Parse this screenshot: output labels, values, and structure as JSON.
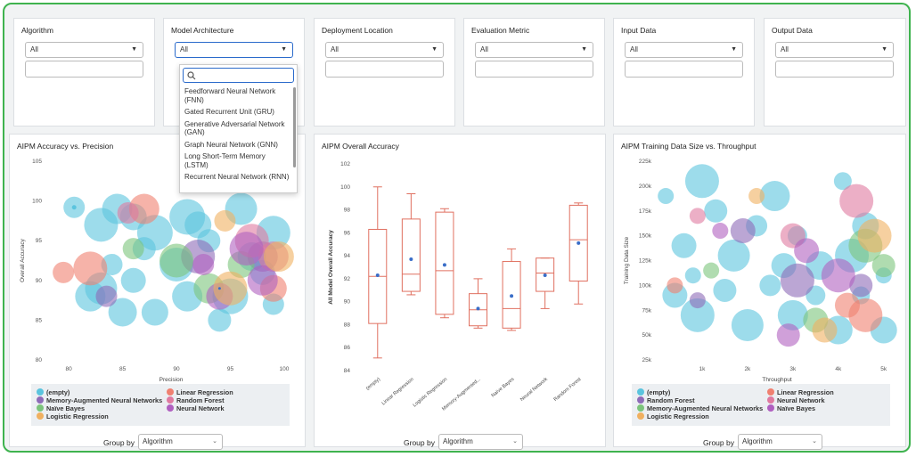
{
  "filters": [
    {
      "label": "Algorithm",
      "value": "All"
    },
    {
      "label": "Model Architecture",
      "value": "All"
    },
    {
      "label": "Deployment Location",
      "value": "All"
    },
    {
      "label": "Evaluation Metric",
      "value": "All"
    },
    {
      "label": "Input Data",
      "value": "All"
    },
    {
      "label": "Output Data",
      "value": "All"
    }
  ],
  "dropdown": {
    "items": [
      "Feedforward Neural Network (FNN)",
      "Gated Recurrent Unit (GRU)",
      "Generative Adversarial Network (GAN)",
      "Graph Neural Network (GNN)",
      "Long Short-Term Memory (LSTM)",
      "Recurrent Neural Network (RNN)"
    ]
  },
  "colors": {
    "empty": "#5bc4de",
    "memory": "#8e6bb8",
    "naive": "#7cc47c",
    "logistic": "#f0b060",
    "linear": "#f08070",
    "random": "#e07aa0",
    "neural": "#b060c0",
    "box": "#e07060",
    "mean": "#3a6ec8",
    "accent": "#3fb34f"
  },
  "charts": {
    "scatter": {
      "title": "AIPM Accuracy vs. Precision",
      "xlabel": "Precision",
      "ylabel": "Overall Accuracy",
      "xticks": [
        "80",
        "85",
        "90",
        "95",
        "100"
      ],
      "yticks": [
        "80",
        "85",
        "90",
        "95",
        "100",
        "105"
      ],
      "legend": [
        {
          "label": "(empty)",
          "color": "#5bc4de"
        },
        {
          "label": "Linear Regression",
          "color": "#f08070"
        },
        {
          "label": "Memory-Augmented Neural Networks",
          "color": "#8e6bb8"
        },
        {
          "label": "Random Forest",
          "color": "#e07aa0"
        },
        {
          "label": "Naïve Bayes",
          "color": "#7cc47c"
        },
        {
          "label": "Neural Network",
          "color": "#b060c0"
        },
        {
          "label": "Logistic Regression",
          "color": "#f0b060"
        }
      ]
    },
    "box": {
      "title": "AIPM Overall Accuracy",
      "ylabel": "All Model Overall Accuracy",
      "yticks": [
        "84",
        "86",
        "88",
        "90",
        "92",
        "94",
        "96",
        "98",
        "100",
        "102"
      ],
      "categories": [
        "(empty)",
        "Linear Regression",
        "Logistic Regression",
        "Memory-Augmented...",
        "Naïve Bayes",
        "Neural Network",
        "Random Forest"
      ]
    },
    "bubble": {
      "title": "AIPM Training Data Size vs. Throughput",
      "xlabel": "Throughput",
      "ylabel": "Training Data Size",
      "xticks": [
        "1k",
        "2k",
        "3k",
        "4k",
        "5k"
      ],
      "yticks": [
        "25k",
        "50k",
        "75k",
        "100k",
        "125k",
        "150k",
        "175k",
        "200k",
        "225k"
      ],
      "legend": [
        {
          "label": "(empty)",
          "color": "#5bc4de"
        },
        {
          "label": "Linear Regression",
          "color": "#f08070"
        },
        {
          "label": "Random Forest",
          "color": "#8e6bb8"
        },
        {
          "label": "Neural Network",
          "color": "#e07aa0"
        },
        {
          "label": "Memory-Augmented Neural Networks",
          "color": "#7cc47c"
        },
        {
          "label": "Naïve Bayes",
          "color": "#b060c0"
        },
        {
          "label": "Logistic Regression",
          "color": "#f0b060"
        }
      ]
    }
  },
  "groupby": {
    "label": "Group by",
    "value": "Algorithm"
  },
  "chart_data": [
    {
      "type": "scatter",
      "title": "AIPM Accuracy vs. Precision",
      "xlabel": "Precision",
      "ylabel": "Overall Accuracy",
      "xlim": [
        78,
        101
      ],
      "ylim": [
        80,
        105
      ],
      "series": [
        {
          "name": "(empty)",
          "points": [
            [
              80.5,
              99.2
            ],
            [
              83,
              97
            ],
            [
              84.5,
              99
            ],
            [
              86,
              98
            ],
            [
              87,
              94
            ],
            [
              88,
              96
            ],
            [
              83,
              89
            ],
            [
              85,
              86
            ],
            [
              86,
              90
            ],
            [
              84,
              92
            ],
            [
              90,
              92
            ],
            [
              91,
              88
            ],
            [
              92,
              97
            ],
            [
              93,
              95
            ],
            [
              95,
              88
            ],
            [
              96,
              99
            ],
            [
              97,
              93
            ],
            [
              98,
              91
            ],
            [
              99,
              87
            ],
            [
              99,
              96
            ],
            [
              82,
              88
            ],
            [
              88,
              86
            ],
            [
              94,
              85
            ],
            [
              91,
              98
            ]
          ]
        },
        {
          "name": "Linear Regression",
          "points": [
            [
              79.5,
              91
            ],
            [
              82,
              91.5
            ],
            [
              87,
              99
            ],
            [
              99,
              89
            ]
          ]
        },
        {
          "name": "Memory-Augmented Neural Networks",
          "points": [
            [
              83.5,
              88
            ],
            [
              92,
              93
            ],
            [
              98,
              93
            ]
          ]
        },
        {
          "name": "Naïve Bayes",
          "points": [
            [
              86,
              94
            ],
            [
              90,
              92.5
            ],
            [
              93,
              89
            ],
            [
              96,
              92
            ]
          ]
        },
        {
          "name": "Random Forest",
          "points": [
            [
              85.5,
              98.5
            ],
            [
              97,
              95
            ],
            [
              99,
              93
            ]
          ]
        },
        {
          "name": "Neural Network",
          "points": [
            [
              92.5,
              92
            ],
            [
              96.5,
              94
            ],
            [
              98,
              90
            ],
            [
              94,
              88
            ]
          ]
        },
        {
          "name": "Logistic Regression",
          "points": [
            [
              94.5,
              97.5
            ],
            [
              95,
              89
            ],
            [
              99.5,
              93
            ]
          ]
        }
      ]
    },
    {
      "type": "box",
      "title": "AIPM Overall Accuracy",
      "ylabel": "All Model Overall Accuracy",
      "ylim": [
        84,
        102
      ],
      "categories": [
        "(empty)",
        "Linear Regression",
        "Logistic Regression",
        "Memory-Augmented...",
        "Naïve Bayes",
        "Neural Network",
        "Random Forest"
      ],
      "boxes": [
        {
          "min": 85.1,
          "q1": 88.1,
          "median": 92.2,
          "q3": 96.3,
          "max": 100,
          "mean": 92.3
        },
        {
          "min": 90.6,
          "q1": 90.9,
          "median": 92.4,
          "q3": 97.2,
          "max": 99.4,
          "mean": 93.7
        },
        {
          "min": 88.6,
          "q1": 88.9,
          "median": 92.7,
          "q3": 97.8,
          "max": 98.1,
          "mean": 93.2
        },
        {
          "min": 87.7,
          "q1": 87.9,
          "median": 89.3,
          "q3": 90.7,
          "max": 92.0,
          "mean": 89.4
        },
        {
          "min": 87.5,
          "q1": 87.7,
          "median": 89.4,
          "q3": 93.5,
          "max": 94.6,
          "mean": 90.5
        },
        {
          "min": 89.4,
          "q1": 90.9,
          "median": 92.5,
          "q3": 93.8,
          "max": 93.8,
          "mean": 92.3
        },
        {
          "min": 89.8,
          "q1": 91.8,
          "median": 95.4,
          "q3": 98.4,
          "max": 98.6,
          "mean": 95.1
        }
      ]
    },
    {
      "type": "scatter",
      "title": "AIPM Training Data Size vs. Throughput",
      "xlabel": "Throughput",
      "ylabel": "Training Data Size",
      "xlim": [
        0,
        5300
      ],
      "ylim": [
        25000,
        225000
      ],
      "series": [
        {
          "name": "(empty)",
          "points": [
            [
              200,
              190000
            ],
            [
              600,
              140000
            ],
            [
              1000,
              205000
            ],
            [
              1300,
              175000
            ],
            [
              1700,
              130000
            ],
            [
              2200,
              160000
            ],
            [
              2600,
              190000
            ],
            [
              3100,
              150000
            ],
            [
              3600,
              120000
            ],
            [
              4100,
              205000
            ],
            [
              4600,
              160000
            ],
            [
              5000,
              110000
            ],
            [
              400,
              90000
            ],
            [
              900,
              70000
            ],
            [
              1500,
              95000
            ],
            [
              2000,
              60000
            ],
            [
              2500,
              100000
            ],
            [
              3000,
              70000
            ],
            [
              3500,
              90000
            ],
            [
              4000,
              55000
            ],
            [
              4500,
              90000
            ],
            [
              5000,
              55000
            ],
            [
              800,
              110000
            ],
            [
              2800,
              120000
            ],
            [
              4300,
              130000
            ]
          ]
        },
        {
          "name": "Linear Regression",
          "points": [
            [
              400,
              100000
            ],
            [
              4200,
              80000
            ],
            [
              4600,
              70000
            ]
          ]
        },
        {
          "name": "Random Forest",
          "points": [
            [
              900,
              85000
            ],
            [
              1900,
              155000
            ],
            [
              3100,
              105000
            ],
            [
              4500,
              100000
            ]
          ]
        },
        {
          "name": "Neural Network",
          "points": [
            [
              900,
              170000
            ],
            [
              3000,
              150000
            ],
            [
              4400,
              185000
            ]
          ]
        },
        {
          "name": "Memory-Augmented Neural Networks",
          "points": [
            [
              1200,
              115000
            ],
            [
              3500,
              65000
            ],
            [
              4600,
              140000
            ],
            [
              5000,
              120000
            ]
          ]
        },
        {
          "name": "Naïve Bayes",
          "points": [
            [
              1400,
              155000
            ],
            [
              3300,
              135000
            ],
            [
              4000,
              110000
            ],
            [
              2900,
              50000
            ]
          ]
        },
        {
          "name": "Logistic Regression",
          "points": [
            [
              2200,
              190000
            ],
            [
              3700,
              55000
            ],
            [
              4800,
              150000
            ]
          ]
        }
      ]
    }
  ]
}
